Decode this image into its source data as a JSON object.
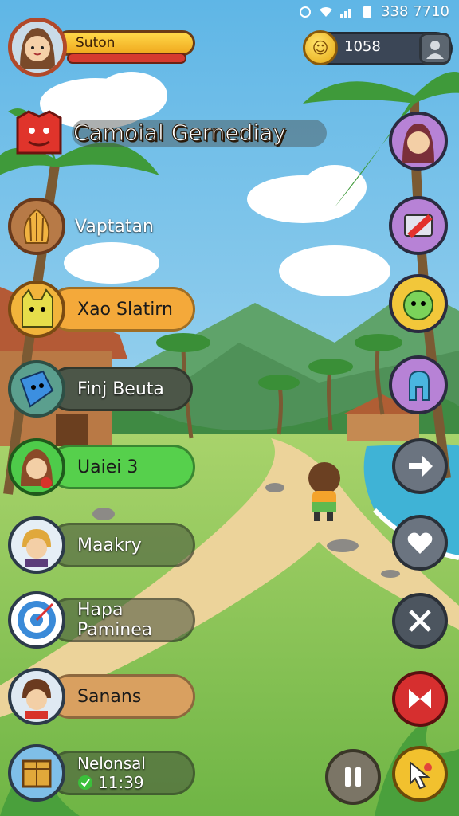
{
  "status_bar": {
    "time": "338 7710"
  },
  "player": {
    "name": "Suton"
  },
  "currency": {
    "coins": "1058"
  },
  "title": "Camoial Gernediay",
  "quests": [
    {
      "label": "Vaptatan",
      "icon": "shell-icon"
    },
    {
      "label": "Xao Slatirn",
      "icon": "yellow-creature-icon"
    },
    {
      "label": "Finj Beuta",
      "icon": "blue-cube-icon"
    },
    {
      "label": "Uaiei 3",
      "icon": "girl-avatar-icon"
    },
    {
      "label": "Maakry",
      "icon": "boy-blonde-icon"
    },
    {
      "label": "Hapa Paminea",
      "icon": "target-icon"
    },
    {
      "label": "Sanans",
      "icon": "boy-brown-icon"
    },
    {
      "label": "Nelonsal",
      "sub": "11:39",
      "icon": "crate-icon"
    }
  ],
  "colors": {
    "pill_orange": "#f4a93a",
    "pill_green": "#56d04c",
    "pill_tan": "#d9a060",
    "pill_dark": "#4c5648"
  }
}
